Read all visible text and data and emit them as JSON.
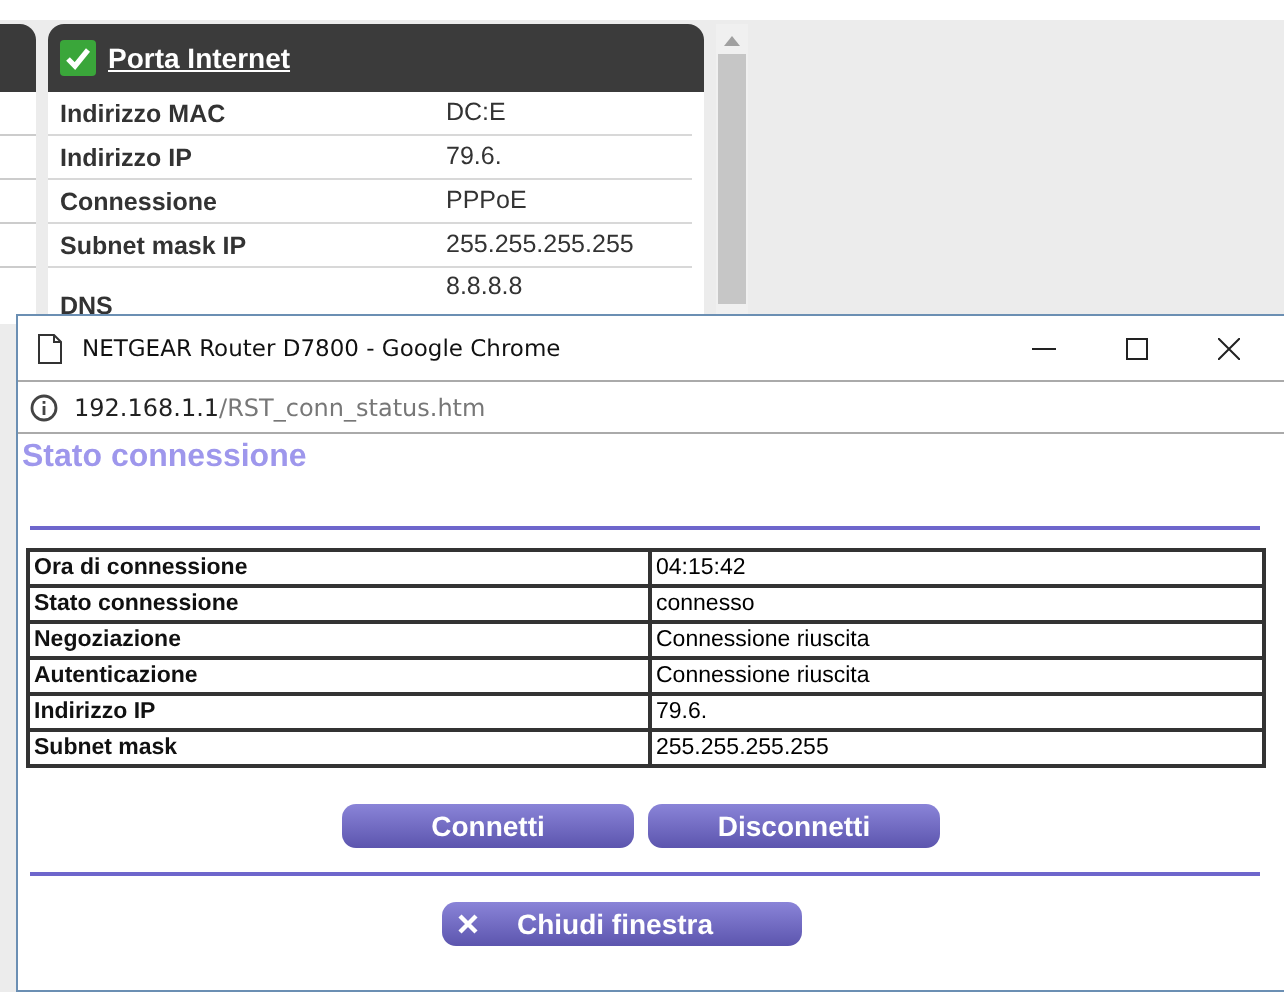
{
  "background_page": {
    "panel": {
      "title": "Porta Internet",
      "status_ok": true,
      "rows": [
        {
          "label": "Indirizzo MAC",
          "value": "DC:E"
        },
        {
          "label": "Indirizzo IP",
          "value": "79.6."
        },
        {
          "label": "Connessione",
          "value": "PPPoE"
        },
        {
          "label": "Subnet mask IP",
          "value": "255.255.255.255"
        },
        {
          "label": "DNS",
          "value": "8.8.8.8"
        }
      ]
    }
  },
  "popup": {
    "window": {
      "title": "NETGEAR Router D7800 - Google Chrome"
    },
    "address_bar": {
      "host": "192.168.1.1",
      "path": "/RST_conn_status.htm"
    },
    "heading": "Stato connessione",
    "table": {
      "rows": [
        {
          "label": "Ora di connessione",
          "value": "04:15:42"
        },
        {
          "label": "Stato connessione",
          "value": "connesso"
        },
        {
          "label": "Negoziazione",
          "value": "Connessione riuscita"
        },
        {
          "label": "Autenticazione",
          "value": "Connessione riuscita"
        },
        {
          "label": "Indirizzo IP",
          "value": "79.6."
        },
        {
          "label": "Subnet mask",
          "value": "255.255.255.255"
        }
      ]
    },
    "buttons": [
      {
        "label": "Connetti"
      },
      {
        "label": "Disconnetti"
      }
    ],
    "close_button": {
      "label": "Chiudi finestra"
    }
  }
}
